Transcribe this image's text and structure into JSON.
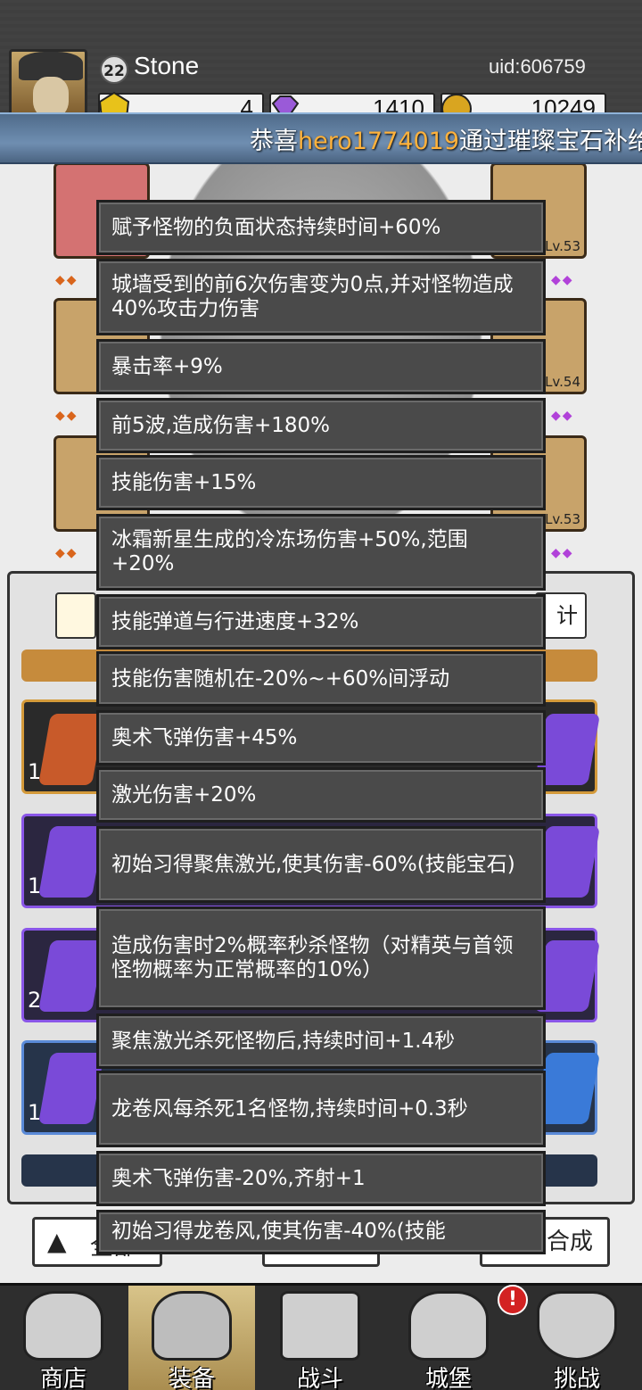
{
  "player": {
    "level": "22",
    "name": "Stone",
    "uid": "uid:606759"
  },
  "currencies": [
    {
      "icon": "yellow-gem-icon",
      "value": "4",
      "color": "#e8c21a"
    },
    {
      "icon": "purple-diamond-icon",
      "value": "1410",
      "color": "#9a5ad8"
    },
    {
      "icon": "gold-coin-icon",
      "value": "10249",
      "color": "#d9a520"
    }
  ],
  "announcement": {
    "prefix": "恭喜",
    "highlight": "hero1774019",
    "suffix": "通过璀璨宝石补给"
  },
  "slots": [
    {
      "lv": ""
    },
    {
      "lv": "Lv.53"
    },
    {
      "lv": "Lv.54"
    },
    {
      "lv": "Lv.53"
    }
  ],
  "panel": {
    "right_button": "计",
    "bottom_left": "全部",
    "bottom_right": "键合成"
  },
  "row_counts": [
    "1",
    "1",
    "2",
    "1"
  ],
  "tooltips": [
    "赋予怪物的负面状态持续时间+60%",
    "城墙受到的前6次伤害变为0点,并对怪物造成40%攻击力伤害",
    "暴击率+9%",
    "前5波,造成伤害+180%",
    "技能伤害+15%",
    "冰霜新星生成的冷冻场伤害+50%,范围+20%",
    "技能弹道与行进速度+32%",
    "技能伤害随机在-20%~+60%间浮动",
    "奥术飞弹伤害+45%",
    "激光伤害+20%",
    "初始习得聚焦激光,使其伤害-60%(技能宝石)",
    "造成伤害时2%概率秒杀怪物（对精英与首领怪物概率为正常概率的10%）",
    "聚焦激光杀死怪物后,持续时间+1.4秒",
    "龙卷风每杀死1名怪物,持续时间+0.3秒",
    "奥术飞弹伤害-20%,齐射+1",
    "初始习得龙卷风,使其伤害-40%(技能"
  ],
  "nav": [
    {
      "label": "商店",
      "icon": "shop-icon"
    },
    {
      "label": "装备",
      "icon": "backpack-icon"
    },
    {
      "label": "战斗",
      "icon": "crossed-swords-icon"
    },
    {
      "label": "城堡",
      "icon": "castle-icon"
    },
    {
      "label": "挑战",
      "icon": "challenge-shield-icon"
    }
  ],
  "nav_alert": "!"
}
